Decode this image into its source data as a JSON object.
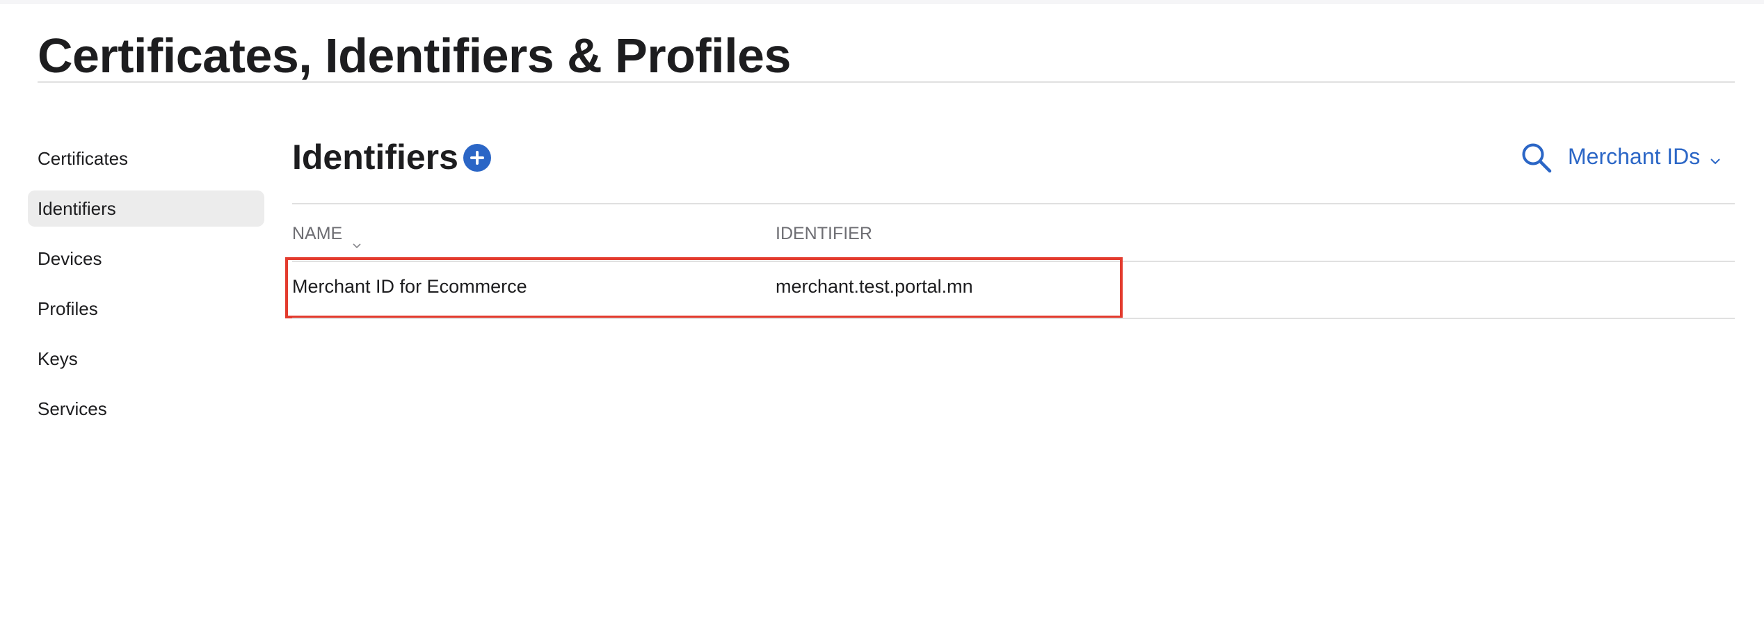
{
  "header": {
    "title": "Certificates, Identifiers & Profiles"
  },
  "sidebar": {
    "items": [
      {
        "label": "Certificates",
        "active": false
      },
      {
        "label": "Identifiers",
        "active": true
      },
      {
        "label": "Devices",
        "active": false
      },
      {
        "label": "Profiles",
        "active": false
      },
      {
        "label": "Keys",
        "active": false
      },
      {
        "label": "Services",
        "active": false
      }
    ]
  },
  "main": {
    "section_title": "Identifiers",
    "add_icon": "plus-circle-icon",
    "search_icon": "search-icon",
    "filter": {
      "label": "Merchant IDs",
      "icon": "chevron-down-icon"
    },
    "table": {
      "columns": [
        "NAME",
        "IDENTIFIER"
      ],
      "sort_icon": "chevron-down-icon",
      "rows": [
        {
          "name": "Merchant ID for Ecommerce",
          "identifier": "merchant.test.portal.mn"
        }
      ]
    }
  },
  "colors": {
    "accent": "#2b66c6",
    "highlight_border": "#e33b2e",
    "selected_bg": "#ececec",
    "divider": "#e0e0e0"
  }
}
